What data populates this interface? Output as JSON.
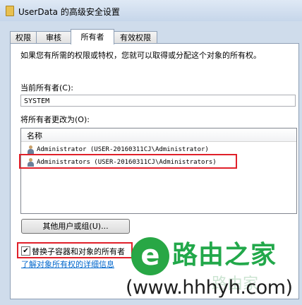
{
  "window": {
    "title": "UserData 的高级安全设置"
  },
  "tabs": [
    {
      "label": "权限"
    },
    {
      "label": "审核"
    },
    {
      "label": "所有者"
    },
    {
      "label": "有效权限"
    }
  ],
  "owner": {
    "description": "如果您有所需的权限或特权，您就可以取得或分配这个对象的所有权。",
    "current_owner_label": "当前所有者(C):",
    "current_owner_value": "SYSTEM",
    "change_to_label": "将所有者更改为(O):",
    "list_header": "名称",
    "list_items": [
      {
        "name": "Administrator (USER-20160311CJ\\Administrator)",
        "icon": "user-icon"
      },
      {
        "name": "Administrators (USER-20160311CJ\\Administrators)",
        "icon": "group-icon",
        "selected": true
      }
    ],
    "other_users_button": "其他用户或组(U)...",
    "replace_checkbox_label": "替换子容器和对象的所有者",
    "replace_checked": true,
    "learn_more_link": "了解对象所有权的详细信息"
  },
  "watermark": {
    "logo_glyph": "e",
    "brand": "路由之家",
    "ghost_brand": "路由家",
    "url": "(www.hhhyh.com)"
  },
  "colors": {
    "highlight_box": "#e0202a",
    "link": "#0066cc",
    "brand_green": "#22a84a"
  }
}
